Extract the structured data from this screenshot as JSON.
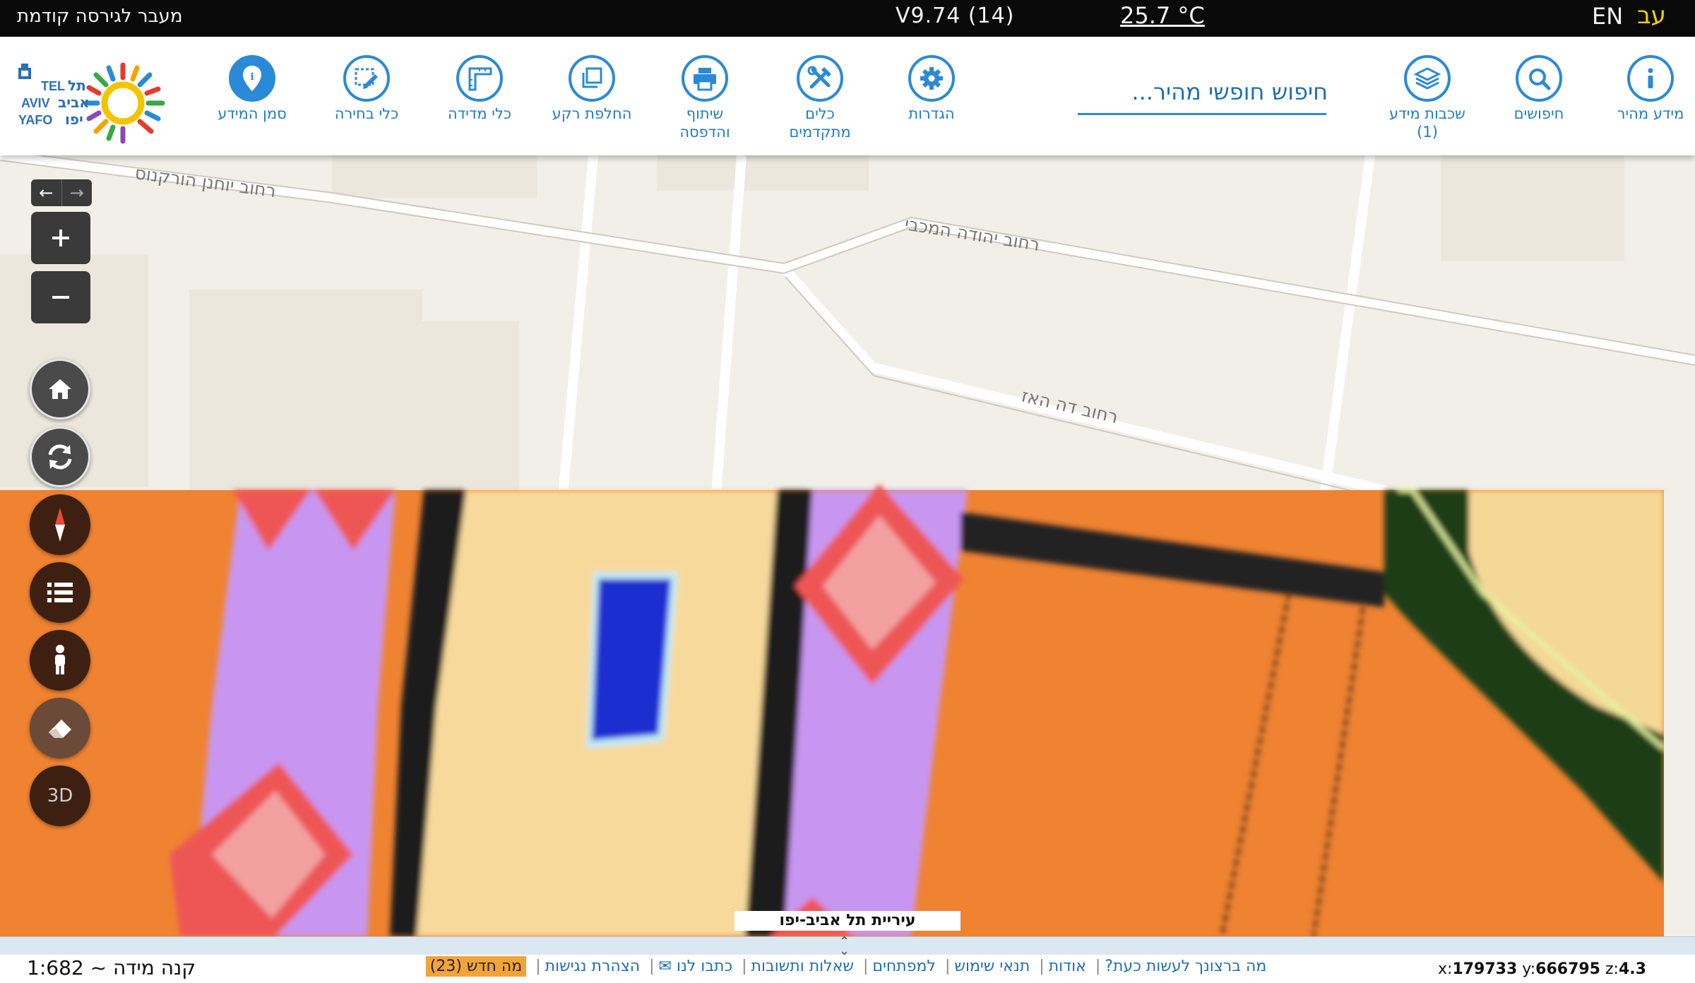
{
  "topbar": {
    "prev_version": "מעבר לגירסה קודמת",
    "version": "V9.74 (14)",
    "temperature": "25.7 °C",
    "lang_en": "EN",
    "lang_he": "עב"
  },
  "toolbar": {
    "quick_info": "מידע מהיר",
    "searches": "חיפושים",
    "layers_line1": "שכבות מידע",
    "layers_line2": "(1)",
    "search_placeholder": "חיפוש חופשי מהיר...",
    "settings": "הגדרות",
    "advanced_line1": "כלים",
    "advanced_line2": "מתקדמים",
    "share_line1": "שיתוף",
    "share_line2": "והדפסה",
    "basemap": "החלפת רקע",
    "measure": "כלי מדידה",
    "select": "כלי בחירה",
    "marker": "סמן המידע"
  },
  "logo": {
    "tel": "TEL",
    "aviv": "AVIV",
    "yafo": "YAFO",
    "he1": "תל",
    "he2": "אביב",
    "he3": "יפו"
  },
  "map": {
    "streets": [
      "רחוב יוחנן הורקנוס",
      "רחוב יהודה המכבי",
      "רחוב דה האז"
    ],
    "municipality_label": "עיריית תל אביב-יפו"
  },
  "side_buttons": {
    "three_d": "3D"
  },
  "footer": {
    "scale": "קנה מידה ~ 1:682",
    "links": [
      "מה ברצונך לעשות כעת?",
      "אודות",
      "תנאי שימוש",
      "למפתחים",
      "שאלות ותשובות",
      "כתבו לנו ✉",
      "הצהרת נגישות"
    ],
    "news": "מה חדש (23)",
    "coord_x_label": "x:",
    "coord_x": "179733",
    "coord_y_label": "y:",
    "coord_y": "666795",
    "coord_z_label": "z:",
    "coord_z": "4.3"
  },
  "colors": {
    "accent": "#2b8ad7",
    "map_orange": "#ef8332",
    "map_purple": "#c896f0",
    "map_red": "#ee5656",
    "map_beige": "#f8d99c",
    "map_blue": "#1a2ed0",
    "map_green": "#1c3d12"
  }
}
